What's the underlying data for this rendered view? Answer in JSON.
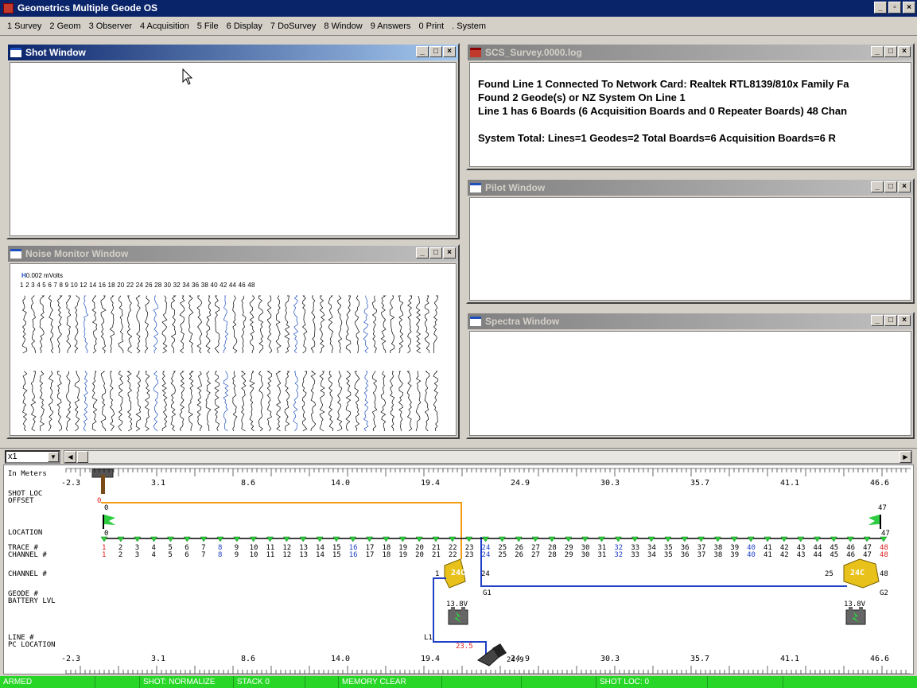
{
  "app": {
    "title": "Geometrics Multiple Geode OS",
    "controls": [
      "_",
      "▫",
      "×"
    ]
  },
  "menu": [
    "1 Survey",
    "2 Geom",
    "3 Observer",
    "4 Acquisition",
    "5 File",
    "6 Display",
    "7 DoSurvey",
    "8 Window",
    "9 Answers",
    "0 Print",
    ". System"
  ],
  "windows": {
    "shot": {
      "title": "Shot Window"
    },
    "noise": {
      "title": "Noise Monitor Window",
      "scale_label": "0.002 mVolts",
      "channel_numbers": "1 2 3 4 5 6 7 8 9 10   12   14   16   18   20   22   24   26   28   30   32   34   36   38   40   42   44   46   48"
    },
    "log": {
      "title": "SCS_Survey.0000.log",
      "lines": [
        "Found Line 1 Connected To Network Card: Realtek RTL8139/810x Family Fa",
        "Found 2 Geode(s) or NZ System On Line 1",
        "Line 1 has 6 Boards (6 Acquisition Boards and 0 Repeater Boards) 48 Chan",
        "",
        "System Total: Lines=1  Geodes=2  Total Boards=6  Acquisition Boards=6  R"
      ]
    },
    "pilot": {
      "title": "Pilot Window"
    },
    "spectra": {
      "title": "Spectra Window"
    }
  },
  "toolbar": {
    "zoom": "x1"
  },
  "survey": {
    "row_labels": [
      "In Meters",
      "SHOT LOC",
      "OFFSET",
      "LOCATION",
      "TRACE #",
      "CHANNEL #",
      "CHANNEL #",
      "GEODE #",
      "BATTERY LVL",
      "LINE #",
      "PC LOCATION"
    ],
    "scale_ticks": [
      "-2.3",
      "3.1",
      "8.6",
      "14.0",
      "19.4",
      "24.9",
      "30.3",
      "35.7",
      "41.1",
      "46.6"
    ],
    "shot_loc": "0",
    "shot_offset": "0",
    "flag_left": "0",
    "flag_right_top": "47",
    "flag_right": "47",
    "trace_start": "1",
    "trace_end": "48",
    "highlight_channels": [
      8,
      16,
      24,
      32,
      40
    ],
    "geodes": [
      {
        "label": "24C",
        "ch_start": "1",
        "ch_end": "24",
        "name": "G1",
        "battery": "13.8V"
      },
      {
        "label": "24C",
        "ch_start": "25",
        "ch_end": "48",
        "name": "G2",
        "battery": "13.8V"
      }
    ],
    "line": "L1",
    "pc_location": "23.5",
    "pc_right_label": "24.9"
  },
  "status": [
    "ARMED",
    "",
    "SHOT: NORMALIZE",
    "STACK 0",
    "",
    "MEMORY CLEAR",
    "",
    "",
    "SHOT LOC: 0",
    "",
    ""
  ],
  "colors": {
    "status_green": "#28d628",
    "title_blue": "#0a246a",
    "orange": "#f39c12",
    "blue_line": "#1f3fc6",
    "red": "#e02020"
  }
}
